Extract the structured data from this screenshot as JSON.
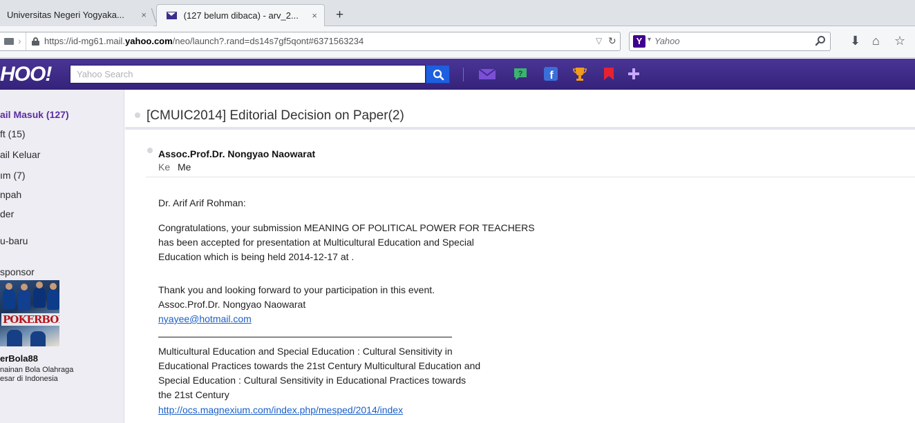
{
  "browser": {
    "tabs": [
      {
        "title": "Universitas Negeri Yogyaka...",
        "close": "×"
      },
      {
        "title": "(127 belum dibaca) - arv_2...",
        "close": "×"
      }
    ],
    "new_tab": "+",
    "url_prefix": "https://id-mg61.mail.",
    "url_domain": "yahoo.com",
    "url_suffix": "/neo/launch?.rand=ds14s7gf5qont#6371563234",
    "search_placeholder": "Yahoo",
    "search_engine_letter": "Y"
  },
  "yahoo": {
    "logo": "HOO!",
    "search_placeholder": "Yahoo Search",
    "accent": "#3f2c8c",
    "search_button_color": "#1d5fe0",
    "header_icons": [
      "mail-icon",
      "answers-icon",
      "facebook-icon",
      "trophy-icon",
      "bookmark-icon",
      "plus-icon"
    ]
  },
  "sidebar": {
    "items": [
      {
        "label": "ail Masuk (127)",
        "active": true
      },
      {
        "label": "ft (15)"
      },
      {
        "label": "ail Keluar"
      },
      {
        "label": "ım (7)"
      },
      {
        "label": "npah"
      },
      {
        "label": "der"
      },
      {
        "label": "u-baru"
      }
    ],
    "sponsor_label": "sponsor",
    "ad": {
      "image_text": "POKERBOL",
      "title": "erBola88",
      "desc_line1": "nainan Bola Olahraga",
      "desc_line2": "esar di Indonesia"
    }
  },
  "message": {
    "subject": "[CMUIC2014] Editorial Decision on Paper(2)",
    "sender": "Assoc.Prof.Dr. Nongyao Naowarat",
    "to_label": "Ke",
    "to_value": "Me",
    "greeting": "Dr. Arif Arif Rohman:",
    "para1": [
      "Congratulations, your submission MEANING OF POLITICAL POWER FOR TEACHERS",
      "has been accepted for presentation at Multicultural Education and Special",
      "Education which is being held 2014-12-17 at ."
    ],
    "para2": [
      "Thank you and looking forward to your participation in this event.",
      "Assoc.Prof.Dr. Nongyao Naowarat"
    ],
    "email_link": "nyayee@hotmail.com",
    "footer": [
      "Multicultural Education and Special Education : Cultural Sensitivity in",
      "Educational Practices  towards the 21st Century Multicultural Education and",
      "Special Education : Cultural Sensitivity in Educational Practices  towards",
      "the 21st Century"
    ],
    "footer_link": "http://ocs.magnexium.com/index.php/mesped/2014/index"
  }
}
